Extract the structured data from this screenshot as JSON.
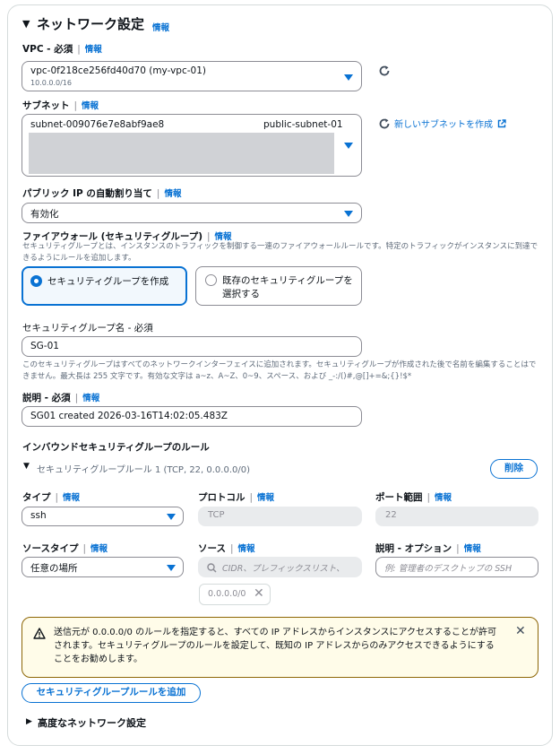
{
  "section": {
    "title": "ネットワーク設定",
    "info": "情報"
  },
  "vpc": {
    "label": "VPC - 必須",
    "info": "情報",
    "value": "vpc-0f218ce256fd40d70 (my-vpc-01)",
    "cidr": "10.0.0.0/16"
  },
  "subnet": {
    "label": "サブネット",
    "info": "情報",
    "value": "subnet-009076e7e8abf9ae8",
    "name": "public-subnet-01",
    "create_link": "新しいサブネットを作成"
  },
  "public_ip": {
    "label": "パブリック IP の自動割り当て",
    "info": "情報",
    "value": "有効化"
  },
  "firewall": {
    "label": "ファイアウォール (セキュリティグループ)",
    "info": "情報",
    "description": "セキュリティグループとは、インスタンスのトラフィックを制御する一連のファイアウォールルールです。特定のトラフィックがインスタンスに到達できるようにルールを追加します。",
    "option_create": "セキュリティグループを作成",
    "option_existing_line1": "既存のセキュリティグループを",
    "option_existing_line2": "選択する"
  },
  "sg_name": {
    "label": "セキュリティグループ名 - 必須",
    "value": "SG-01",
    "hint": "このセキュリティグループはすべてのネットワークインターフェイスに追加されます。セキュリティグループが作成された後で名前を編集することはできません。最大長は 255 文字です。有効な文字は a~z、A~Z、0~9、スペース、および _-:/()#,@[]+=&;{}!$*"
  },
  "sg_desc": {
    "label": "説明 - 必須",
    "info": "情報",
    "value": "SG01 created 2026-03-16T14:02:05.483Z"
  },
  "inbound": {
    "title": "インバウンドセキュリティグループのルール",
    "rule_title": "セキュリティグループルール 1 (TCP, 22, 0.0.0.0/0)",
    "delete_button": "削除",
    "type_label": "タイプ",
    "type_value": "ssh",
    "protocol_label": "プロトコル",
    "protocol_value": "TCP",
    "port_label": "ポート範囲",
    "port_value": "22",
    "source_type_label": "ソースタイプ",
    "source_type_value": "任意の場所",
    "source_label": "ソース",
    "source_placeholder": "CIDR、プレフィックスリスト、",
    "desc_label": "説明 - オプション",
    "desc_placeholder": "例: 管理者のデスクトップの SSH",
    "source_token": "0.0.0.0/0",
    "info": "情報"
  },
  "warning": {
    "text": "送信元が 0.0.0.0/0 のルールを指定すると、すべての IP アドレスからインスタンスにアクセスすることが許可されます。セキュリティグループのルールを設定して、既知の IP アドレスからのみアクセスできるようにすることをお勧めします。"
  },
  "add_rule_button": "セキュリティグループルールを追加",
  "advanced": "高度なネットワーク設定",
  "colors": {
    "accent": "#0972d3",
    "warning_border": "#8d6605",
    "warning_bg": "#fffce9"
  }
}
